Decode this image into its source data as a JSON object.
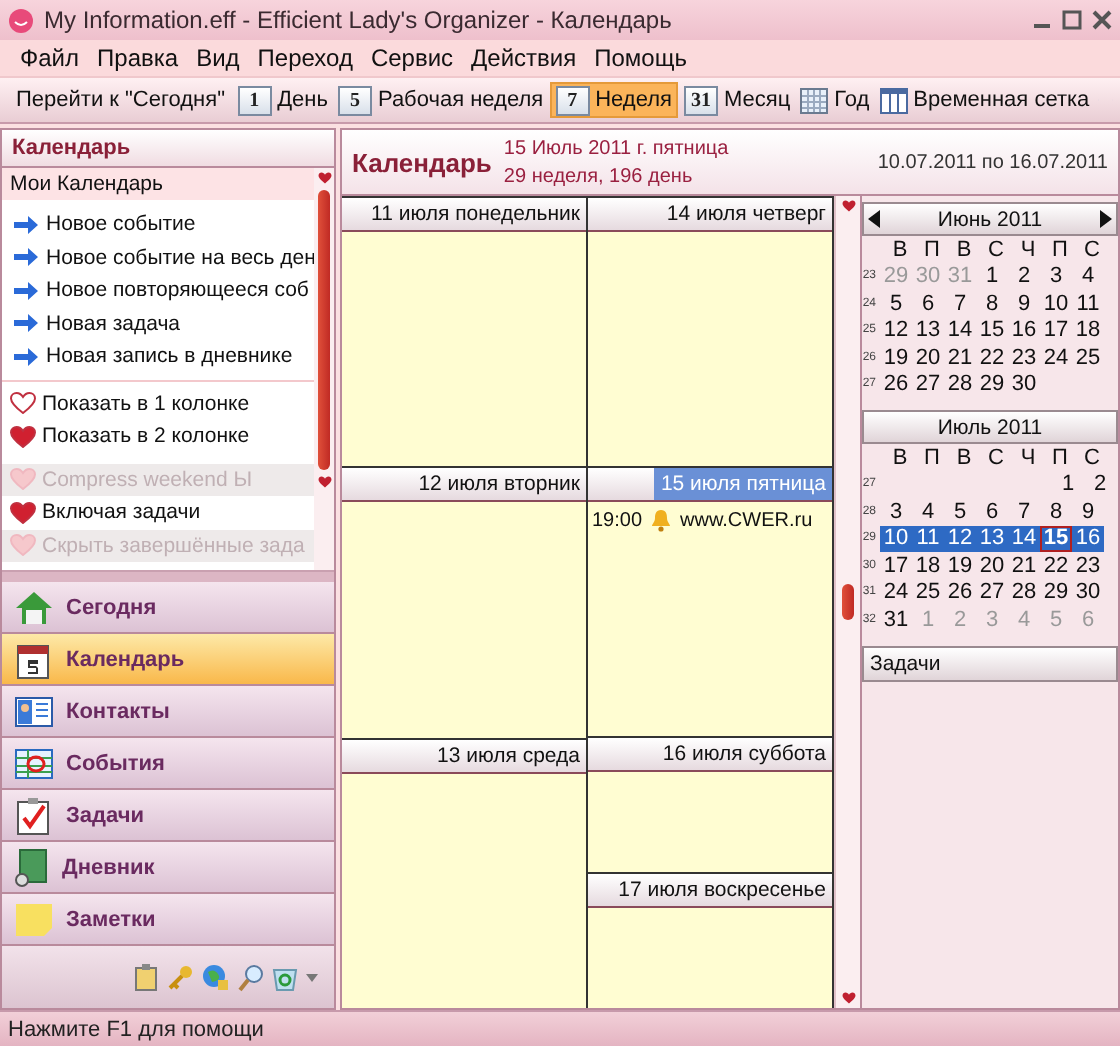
{
  "window": {
    "title": "My Information.eff - Efficient Lady's Organizer - Календарь"
  },
  "menu": [
    "Файл",
    "Правка",
    "Вид",
    "Переход",
    "Сервис",
    "Действия",
    "Помощь"
  ],
  "toolbar": [
    {
      "kind": "text",
      "label": "Перейти к \"Сегодня\"",
      "selected": false
    },
    {
      "kind": "page",
      "icon_text": "1",
      "label": "День",
      "selected": false
    },
    {
      "kind": "page",
      "icon_text": "5",
      "label": "Рабочая неделя",
      "selected": false
    },
    {
      "kind": "page",
      "icon_text": "7",
      "label": "Неделя",
      "selected": true
    },
    {
      "kind": "page",
      "icon_text": "31",
      "label": "Месяц",
      "selected": false
    },
    {
      "kind": "grid",
      "label": "Год",
      "selected": false
    },
    {
      "kind": "columns",
      "label": "Временная сетка",
      "selected": false
    }
  ],
  "sidebar": {
    "title": "Календарь",
    "list_header": "Мои Календарь",
    "actions": [
      "Новое событие",
      "Новое событие на весь ден",
      "Новое повторяющееся соб",
      "Новая задача",
      "Новая запись в дневнике"
    ],
    "options": [
      {
        "label": "Показать в 1 колонке",
        "checked": false,
        "disabled": false
      },
      {
        "label": "Показать в 2 колонке",
        "checked": true,
        "disabled": false
      },
      {
        "label": "Compress weekend Ы",
        "checked": false,
        "disabled": true
      },
      {
        "label": "Включая задачи",
        "checked": true,
        "disabled": false
      },
      {
        "label": "Скрыть завершённые зада",
        "checked": false,
        "disabled": true
      }
    ],
    "nav": [
      {
        "kind": "home",
        "label": "Сегодня",
        "selected": false
      },
      {
        "kind": "calendar",
        "label": "Календарь",
        "selected": true
      },
      {
        "kind": "contacts",
        "label": "Контакты",
        "selected": false
      },
      {
        "kind": "events",
        "label": "События",
        "selected": false
      },
      {
        "kind": "tasks",
        "label": "Задачи",
        "selected": false
      },
      {
        "kind": "diary",
        "label": "Дневник",
        "selected": false
      },
      {
        "kind": "notes",
        "label": "Заметки",
        "selected": false
      }
    ]
  },
  "calendar": {
    "title": "Календарь",
    "date": "15 Июль 2011 г. пятница",
    "week_info": "29 неделя, 196 день",
    "range": "10.07.2011 по 16.07.2011",
    "days": [
      {
        "label": "11 июля понедельник",
        "kind": "weekday",
        "selected": false
      },
      {
        "label": "12 июля вторник",
        "kind": "weekday",
        "selected": false
      },
      {
        "label": "13 июля среда",
        "kind": "weekday",
        "selected": false
      },
      {
        "label": "14 июля четверг",
        "kind": "weekday",
        "selected": false
      },
      {
        "label": "15 июля пятница",
        "kind": "weekday",
        "selected": true,
        "events": [
          {
            "time": "19:00",
            "text": "www.CWER.ru"
          }
        ]
      },
      {
        "label": "16 июля суббота",
        "kind": "weekend",
        "selected": false
      },
      {
        "label": "17 июля воскресенье",
        "kind": "weekend",
        "selected": false
      }
    ]
  },
  "mini_calendars": [
    {
      "title": "Июнь 2011",
      "arrows": true,
      "weekdays": [
        "В",
        "П",
        "В",
        "С",
        "Ч",
        "П",
        "С"
      ],
      "weeks": [
        {
          "num": "23",
          "days": [
            {
              "d": "29",
              "other": true
            },
            {
              "d": "30",
              "other": true
            },
            {
              "d": "31",
              "other": true
            },
            {
              "d": "1"
            },
            {
              "d": "2"
            },
            {
              "d": "3"
            },
            {
              "d": "4"
            }
          ]
        },
        {
          "num": "24",
          "days": [
            {
              "d": "5"
            },
            {
              "d": "6"
            },
            {
              "d": "7"
            },
            {
              "d": "8"
            },
            {
              "d": "9"
            },
            {
              "d": "10"
            },
            {
              "d": "11"
            }
          ]
        },
        {
          "num": "25",
          "days": [
            {
              "d": "12"
            },
            {
              "d": "13"
            },
            {
              "d": "14"
            },
            {
              "d": "15"
            },
            {
              "d": "16"
            },
            {
              "d": "17"
            },
            {
              "d": "18"
            }
          ]
        },
        {
          "num": "26",
          "days": [
            {
              "d": "19"
            },
            {
              "d": "20"
            },
            {
              "d": "21"
            },
            {
              "d": "22"
            },
            {
              "d": "23"
            },
            {
              "d": "24"
            },
            {
              "d": "25"
            }
          ]
        },
        {
          "num": "27",
          "days": [
            {
              "d": "26"
            },
            {
              "d": "27"
            },
            {
              "d": "28"
            },
            {
              "d": "29"
            },
            {
              "d": "30"
            }
          ]
        }
      ]
    },
    {
      "title": "Июль 2011",
      "arrows": false,
      "weekdays": [
        "В",
        "П",
        "В",
        "С",
        "Ч",
        "П",
        "С"
      ],
      "weeks": [
        {
          "num": "27",
          "right_aligned": true,
          "days": [
            {
              "d": "1"
            },
            {
              "d": "2"
            }
          ]
        },
        {
          "num": "28",
          "days": [
            {
              "d": "3"
            },
            {
              "d": "4"
            },
            {
              "d": "5"
            },
            {
              "d": "6"
            },
            {
              "d": "7"
            },
            {
              "d": "8"
            },
            {
              "d": "9"
            }
          ]
        },
        {
          "num": "29",
          "days": [
            {
              "d": "10",
              "selected": true
            },
            {
              "d": "11",
              "selected": true
            },
            {
              "d": "12",
              "selected": true
            },
            {
              "d": "13",
              "selected": true
            },
            {
              "d": "14",
              "selected": true
            },
            {
              "d": "15",
              "selected": true,
              "today": true
            },
            {
              "d": "16",
              "selected": true
            }
          ]
        },
        {
          "num": "30",
          "days": [
            {
              "d": "17"
            },
            {
              "d": "18"
            },
            {
              "d": "19"
            },
            {
              "d": "20"
            },
            {
              "d": "21"
            },
            {
              "d": "22"
            },
            {
              "d": "23"
            }
          ]
        },
        {
          "num": "31",
          "days": [
            {
              "d": "24"
            },
            {
              "d": "25"
            },
            {
              "d": "26"
            },
            {
              "d": "27"
            },
            {
              "d": "28"
            },
            {
              "d": "29"
            },
            {
              "d": "30"
            }
          ]
        },
        {
          "num": "32",
          "days": [
            {
              "d": "31"
            },
            {
              "d": "1",
              "other": true
            },
            {
              "d": "2",
              "other": true
            },
            {
              "d": "3",
              "other": true
            },
            {
              "d": "4",
              "other": true
            },
            {
              "d": "5",
              "other": true
            },
            {
              "d": "6",
              "other": true
            }
          ]
        }
      ]
    }
  ],
  "tasks_panel": {
    "title": "Задачи"
  },
  "status_bar": "Нажмите F1 для помощи"
}
